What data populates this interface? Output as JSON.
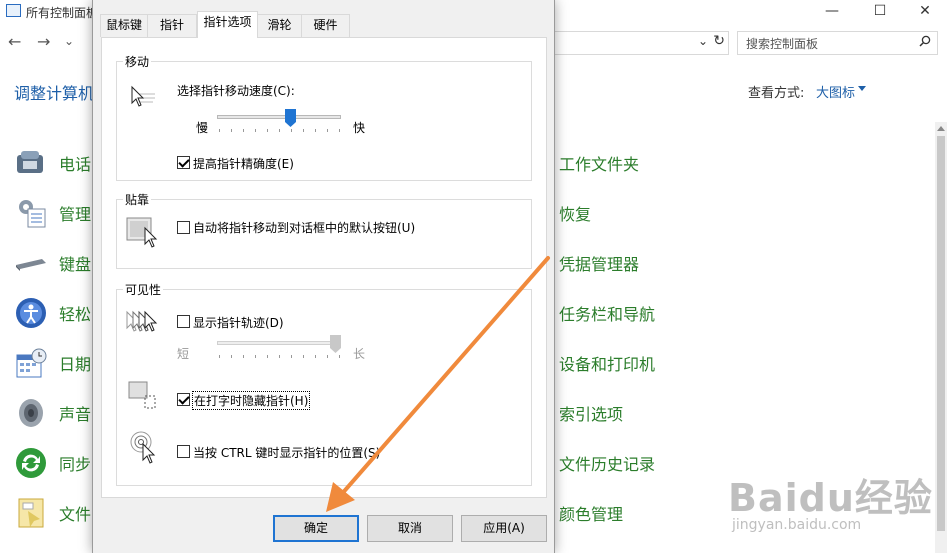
{
  "control_panel": {
    "window_title": "所有控制面板",
    "window_controls": [
      "—",
      "☐",
      "✕"
    ],
    "nav": {
      "back": "←",
      "forward": "→",
      "down": "⌄",
      "up": "↑"
    },
    "address_dropdown": "⌄",
    "refresh": "↻",
    "search_placeholder": "搜索控制面板",
    "heading": "调整计算机",
    "view_by_label": "查看方式:",
    "view_by_value": "大图标",
    "left_items": [
      {
        "label": "电话",
        "icon": "phone-modem-icon"
      },
      {
        "label": "管理",
        "icon": "admin-tools-icon"
      },
      {
        "label": "键盘",
        "icon": "keyboard-icon"
      },
      {
        "label": "轻松",
        "icon": "ease-of-access-icon"
      },
      {
        "label": "日期",
        "icon": "date-time-icon"
      },
      {
        "label": "声音",
        "icon": "speaker-icon"
      },
      {
        "label": "同步",
        "icon": "sync-center-icon"
      },
      {
        "label": "文件",
        "icon": "file-explorer-icon"
      }
    ],
    "right_items": [
      "工作文件夹",
      "恢复",
      "凭据管理器",
      "任务栏和导航",
      "设备和打印机",
      "索引选项",
      "文件历史记录",
      "颜色管理"
    ]
  },
  "dialog": {
    "tabs": [
      "鼠标键",
      "指针",
      "指针选项",
      "滑轮",
      "硬件"
    ],
    "active_tab": "指针选项",
    "motion": {
      "title": "移动",
      "speed_label": "选择指针移动速度(C):",
      "slow": "慢",
      "fast": "快",
      "speed_level": 0.6,
      "precision_label": "提高指针精确度(E)",
      "precision_checked": true
    },
    "snap": {
      "title": "贴靠",
      "label": "自动将指针移动到对话框中的默认按钮(U)",
      "checked": false
    },
    "visibility": {
      "title": "可见性",
      "trails_label": "显示指针轨迹(D)",
      "trails_checked": false,
      "short": "短",
      "long": "长",
      "trails_level": 1.0,
      "hide_label": "在打字时隐藏指针(H)",
      "hide_checked": true,
      "ctrl_label": "当按 CTRL 键时显示指针的位置(S)",
      "ctrl_checked": false
    },
    "buttons": {
      "ok": "确定",
      "cancel": "取消",
      "apply": "应用(A)"
    }
  },
  "watermark": {
    "brand": "Baidu经验",
    "url": "jingyan.baidu.com"
  },
  "colors": {
    "link_blue": "#1e5fa8",
    "item_green": "#2b7d2b",
    "annotation_orange": "#f08a3c",
    "accent": "#1f74d2"
  }
}
